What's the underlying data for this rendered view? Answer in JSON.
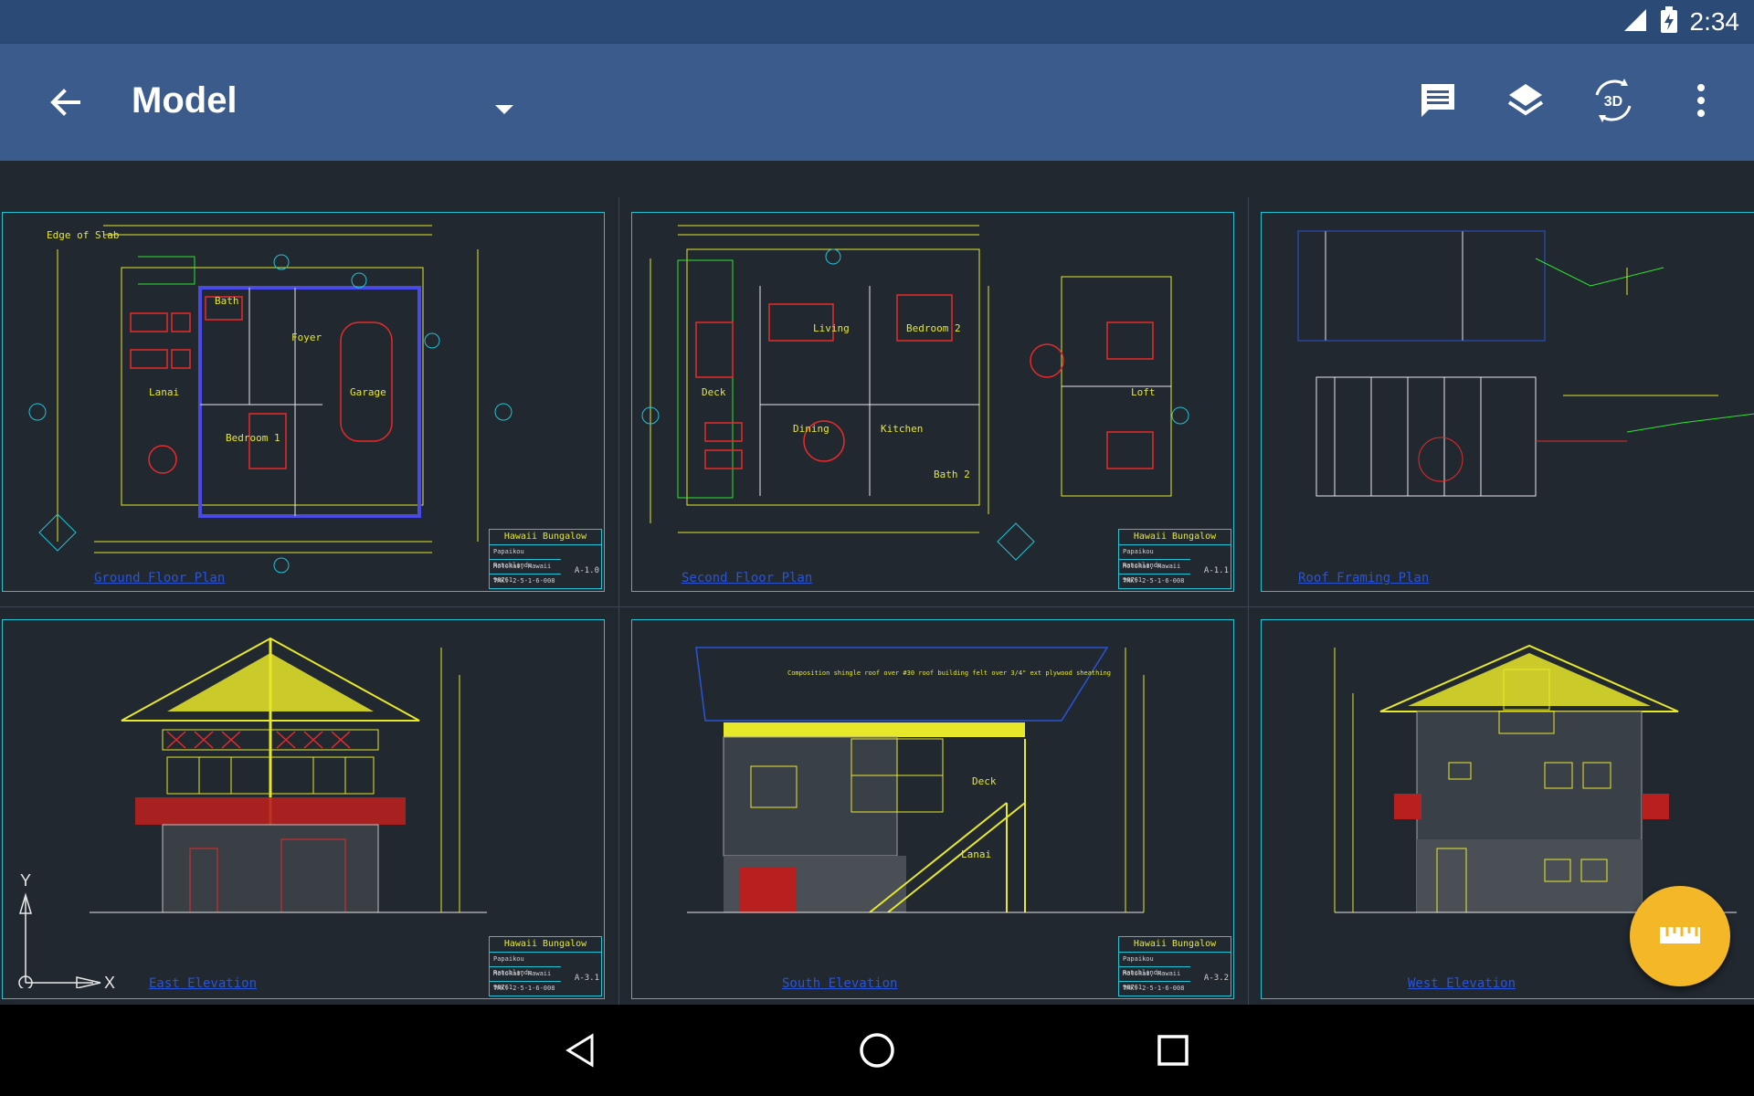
{
  "status_bar": {
    "time": "2:34",
    "icons": [
      "signal-icon",
      "battery-icon"
    ]
  },
  "app_bar": {
    "title": "Model",
    "icons": {
      "back": "arrow-back-icon",
      "dropdown": "dropdown-arrow-icon",
      "comments": "comment-icon",
      "layers": "layers-icon",
      "view_3d": "3d-rotate-icon",
      "more": "more-vert-icon"
    },
    "view_3d_label": "3D"
  },
  "sheets": [
    {
      "project": "Hawaii Bungalow",
      "line1": "Papaikou Ranchlands",
      "line2": "Molokai, Hawaii 96761",
      "line3": "TMK: 2-5-1-6-008",
      "sheet_id": "A-1.0",
      "label": "Ground Floor Plan"
    },
    {
      "project": "Hawaii Bungalow",
      "line1": "Papaikou Ranchlands",
      "line2": "Molokai, Hawaii 96761",
      "line3": "TMK: 2-5-1-6-008",
      "sheet_id": "A-1.1",
      "label": "Second Floor Plan"
    },
    {
      "project": "",
      "line1": "",
      "line2": "",
      "line3": "",
      "sheet_id": "",
      "label": "Roof Framing Plan"
    },
    {
      "project": "Hawaii Bungalow",
      "line1": "Papaikou Ranchlands",
      "line2": "Molokai, Hawaii 96761",
      "line3": "TMK: 2-5-1-6-008",
      "sheet_id": "A-3.1",
      "label": "East Elevation"
    },
    {
      "project": "Hawaii Bungalow",
      "line1": "Papaikou Ranchlands",
      "line2": "Molokai, Hawaii 96761",
      "line3": "TMK: 2-5-1-6-008",
      "sheet_id": "A-3.2",
      "label": "South Elevation"
    },
    {
      "project": "",
      "line1": "",
      "line2": "",
      "line3": "",
      "sheet_id": "",
      "label": "West Elevation"
    }
  ],
  "drawing_text": {
    "rooms": [
      "Bath",
      "Foyer",
      "Lanai",
      "Bedroom 1",
      "Garage",
      "Living",
      "Bedroom 2",
      "Deck",
      "Dining",
      "Kitchen",
      "Bath 2",
      "Loft"
    ],
    "edge_note": "Edge of Slab",
    "elev_note": "Composition shingle roof over #30 roof building felt over 3/4\" ext plywood sheathing",
    "deck_label": "Deck",
    "lanai_label": "Lanai"
  },
  "ucs": {
    "x_label": "X",
    "y_label": "Y"
  },
  "fab": {
    "icon": "ruler-icon"
  },
  "nav_bar": {
    "icons": [
      "back-triangle-icon",
      "home-circle-icon",
      "recents-square-icon"
    ]
  },
  "colors": {
    "status_bar": "#2b4a76",
    "app_bar": "#3b5b8c",
    "canvas": "#212830",
    "sheet_border": "#21c4d6",
    "fab": "#f4b728"
  }
}
